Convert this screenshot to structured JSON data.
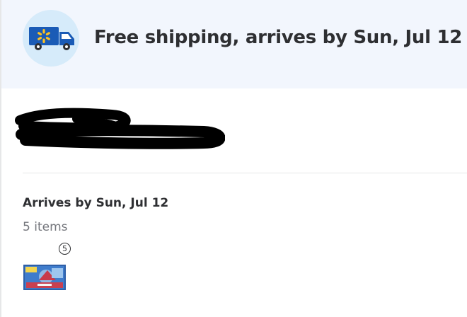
{
  "banner": {
    "title": "Free shipping, arrives by Sun, Jul 12",
    "icon": "delivery-truck-icon",
    "truck_color": "#1a5bb6",
    "spark_color": "#ffc220"
  },
  "shipment": {
    "heading": "Arrives by Sun, Jul 12",
    "items_count": "5 items",
    "quantity_badge": "5",
    "product_thumbnail": "product-box-thumbnail"
  }
}
